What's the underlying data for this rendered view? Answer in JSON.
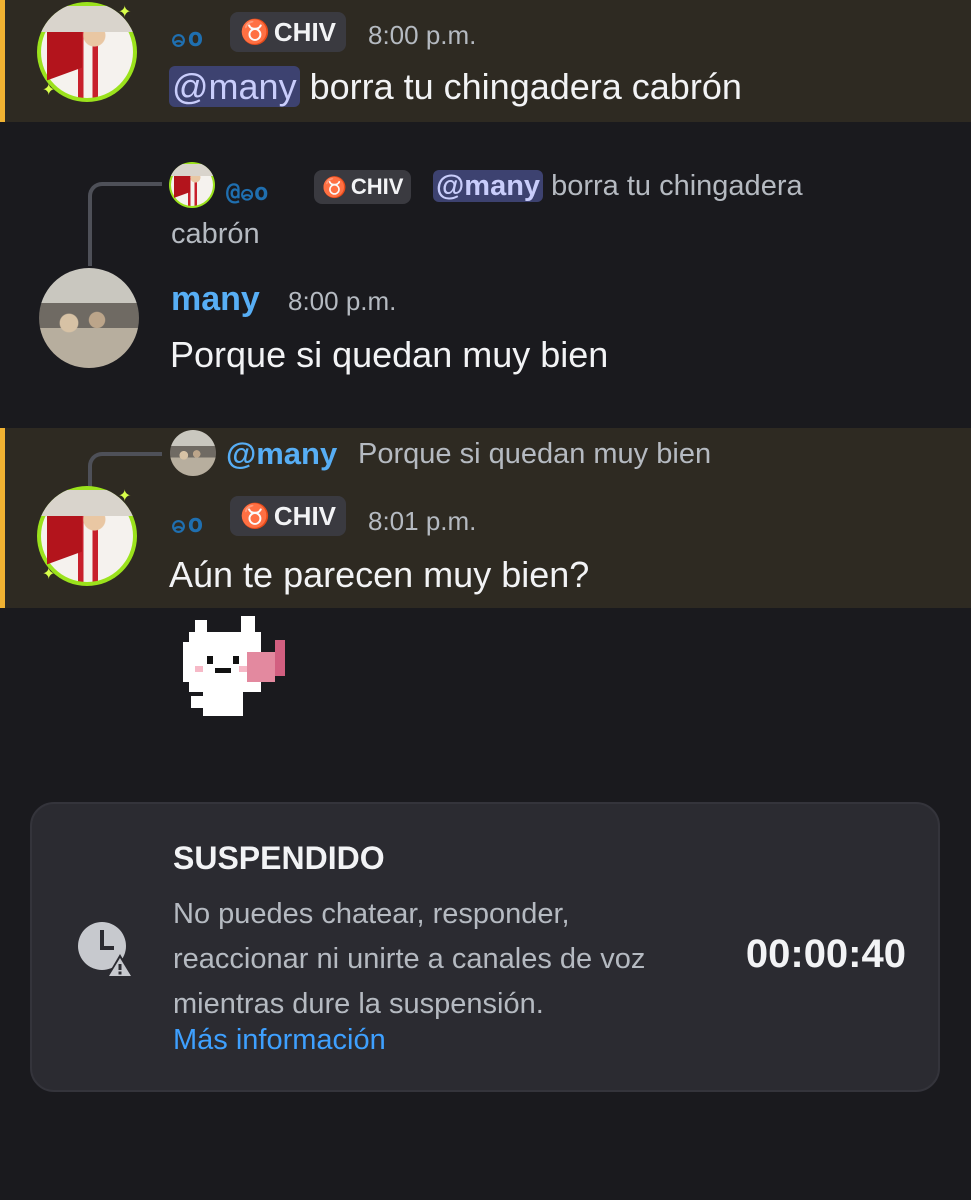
{
  "messages": [
    {
      "author": "ဓo",
      "role_tag": "CHIV",
      "time": "8:00 p.m.",
      "mention": "@many",
      "text": " borra tu chingadera cabrón"
    },
    {
      "reply_to": {
        "author": "@ဓo",
        "role_tag": "CHIV",
        "mention": "@many",
        "text_line1": " borra tu chingadera",
        "text_line2": "cabrón"
      },
      "author": "many",
      "time": "8:00 p.m.",
      "text": "Porque si quedan muy bien"
    },
    {
      "reply_to": {
        "author": "@many",
        "text": "Porque si quedan muy bien"
      },
      "author": "ဓo",
      "role_tag": "CHIV",
      "time": "8:01 p.m.",
      "text": "Aún te parecen muy bien?",
      "sticker": "pixel-cat-sticker"
    }
  ],
  "suspension": {
    "title": "SUSPENDIDO",
    "description": "No puedes chatear, responder, reaccionar ni unirte a canales de voz mientras dure la suspensión.",
    "link": "Más información",
    "timer": "00:00:40",
    "icon": "clock-warning-icon"
  },
  "colors": {
    "background": "#1a1a1e",
    "highlight": "#2e2a22",
    "highlight_border": "#f0b232",
    "mention_bg": "#3d4270",
    "username_many": "#57aef5",
    "link": "#3ea0ff"
  }
}
